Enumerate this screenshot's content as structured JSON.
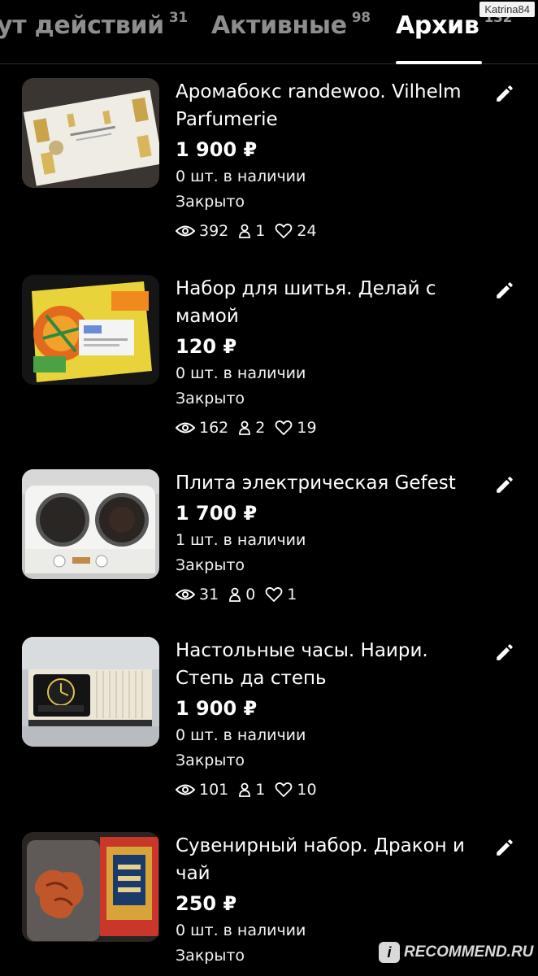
{
  "header": {
    "tabs": [
      {
        "label": "ут действий",
        "count": "31"
      },
      {
        "label": "Активные",
        "count": "98"
      },
      {
        "label": "Архив",
        "count": "132"
      }
    ],
    "active_tab": 2,
    "username_badge": "Katrina84"
  },
  "items": [
    {
      "title_line1": "Аромабокс randewoo. Vilhelm",
      "title_line2": "Parfumerie",
      "price": "1 900 ₽",
      "stock": "0 шт. в наличии",
      "status": "Закрыто",
      "views": "392",
      "buyers": "1",
      "likes": "24"
    },
    {
      "title_line1": "Набор для шитья. Делай с",
      "title_line2": "мамой",
      "price": "120 ₽",
      "stock": "0 шт. в наличии",
      "status": "Закрыто",
      "views": "162",
      "buyers": "2",
      "likes": "19"
    },
    {
      "title_line1": "Плита электрическая Gefest",
      "title_line2": "",
      "price": "1 700 ₽",
      "stock": "1 шт. в наличии",
      "status": "Закрыто",
      "views": "31",
      "buyers": "0",
      "likes": "1"
    },
    {
      "title_line1": "Настольные часы. Наири.",
      "title_line2": "Степь да степь",
      "price": "1 900 ₽",
      "stock": "0 шт. в наличии",
      "status": "Закрыто",
      "views": "101",
      "buyers": "1",
      "likes": "10"
    },
    {
      "title_line1": "Сувенирный набор. Дракон и",
      "title_line2": "чай",
      "price": "250 ₽",
      "stock": "0 шт. в наличии",
      "status": "Закрыто",
      "views": "",
      "buyers": "",
      "likes": ""
    }
  ],
  "icons": {
    "edit": "pencil-icon",
    "views": "eye-icon",
    "buyers": "person-icon",
    "likes": "heart-icon"
  },
  "watermark": {
    "badge": "i",
    "text": "RECOMMEND.RU"
  }
}
